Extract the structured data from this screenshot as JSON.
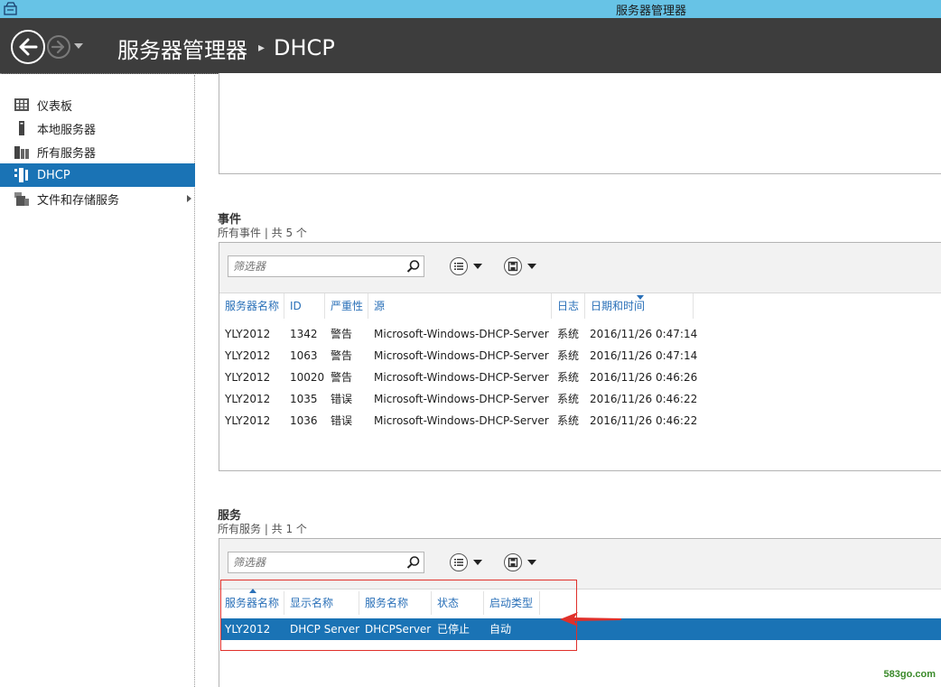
{
  "window": {
    "title": "服务器管理器"
  },
  "header": {
    "breadcrumb": [
      "服务器管理器",
      "DHCP"
    ]
  },
  "sidebar": {
    "items": [
      {
        "label": "仪表板",
        "icon": "dashboard-icon"
      },
      {
        "label": "本地服务器",
        "icon": "server-icon"
      },
      {
        "label": "所有服务器",
        "icon": "servers-icon"
      },
      {
        "label": "DHCP",
        "icon": "dhcp-icon",
        "selected": true
      },
      {
        "label": "文件和存储服务",
        "icon": "storage-icon",
        "has_children": true
      }
    ]
  },
  "events": {
    "title": "事件",
    "subtitle": "所有事件 | 共 5 个",
    "filter_placeholder": "筛选器",
    "columns": [
      "服务器名称",
      "ID",
      "严重性",
      "源",
      "日志",
      "日期和时间"
    ],
    "rows": [
      [
        "YLY2012",
        "1342",
        "警告",
        "Microsoft-Windows-DHCP-Server",
        "系统",
        "2016/11/26 0:47:14"
      ],
      [
        "YLY2012",
        "1063",
        "警告",
        "Microsoft-Windows-DHCP-Server",
        "系统",
        "2016/11/26 0:47:14"
      ],
      [
        "YLY2012",
        "10020",
        "警告",
        "Microsoft-Windows-DHCP-Server",
        "系统",
        "2016/11/26 0:46:26"
      ],
      [
        "YLY2012",
        "1035",
        "错误",
        "Microsoft-Windows-DHCP-Server",
        "系统",
        "2016/11/26 0:46:22"
      ],
      [
        "YLY2012",
        "1036",
        "错误",
        "Microsoft-Windows-DHCP-Server",
        "系统",
        "2016/11/26 0:46:22"
      ]
    ]
  },
  "services": {
    "title": "服务",
    "subtitle": "所有服务 | 共 1 个",
    "filter_placeholder": "筛选器",
    "columns": [
      "服务器名称",
      "显示名称",
      "服务名称",
      "状态",
      "启动类型"
    ],
    "rows": [
      [
        "YLY2012",
        "DHCP Server",
        "DHCPServer",
        "已停止",
        "自动"
      ]
    ]
  },
  "watermark": "583go.com",
  "colors": {
    "accent": "#1a73b5",
    "titlebar": "#67c3e6",
    "header": "#3d3d3d",
    "annotation": "#e0302a"
  }
}
